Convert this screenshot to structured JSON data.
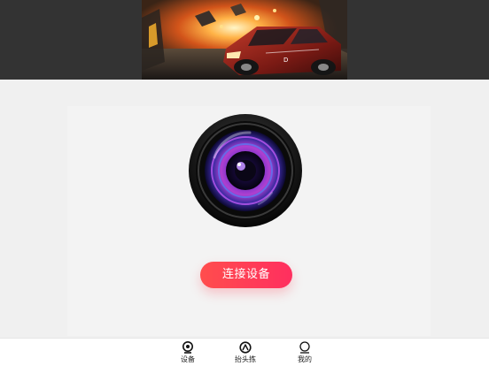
{
  "banner": {
    "image": "racing-game-car-explosion-banner"
  },
  "main": {
    "illustration": "camera-lens-icon",
    "connect_button_label": "连接设备"
  },
  "bottom_nav": {
    "items": [
      {
        "label": "设备",
        "icon": "webcam-icon"
      },
      {
        "label": "抬头拣",
        "icon": "head-up-icon"
      },
      {
        "label": "我的",
        "icon": "user-icon"
      }
    ]
  },
  "colors": {
    "header_bg": "#333333",
    "page_bg": "#f0f0f0",
    "accent_start": "#ff4d4d",
    "accent_end": "#ff2f5f",
    "nav_bg": "#ffffff"
  }
}
